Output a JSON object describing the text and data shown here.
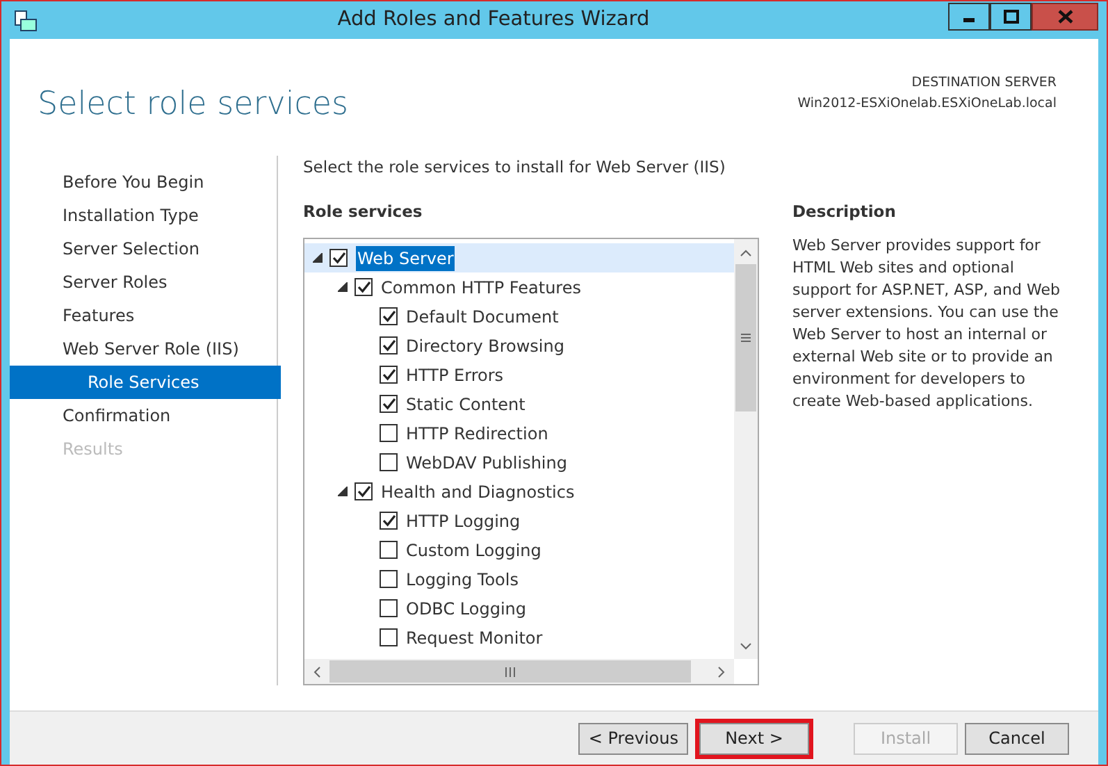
{
  "window": {
    "title": "Add Roles and Features Wizard"
  },
  "header": {
    "title": "Select role services",
    "destination_label": "DESTINATION SERVER",
    "destination_server": "Win2012-ESXiOnelab.ESXiOneLab.local"
  },
  "steps": [
    {
      "label": "Before You Begin",
      "selected": false,
      "disabled": false
    },
    {
      "label": "Installation Type",
      "selected": false,
      "disabled": false
    },
    {
      "label": "Server Selection",
      "selected": false,
      "disabled": false
    },
    {
      "label": "Server Roles",
      "selected": false,
      "disabled": false
    },
    {
      "label": "Features",
      "selected": false,
      "disabled": false
    },
    {
      "label": "Web Server Role (IIS)",
      "selected": false,
      "disabled": false
    },
    {
      "label": "Role Services",
      "selected": true,
      "disabled": false,
      "sub": true
    },
    {
      "label": "Confirmation",
      "selected": false,
      "disabled": false
    },
    {
      "label": "Results",
      "selected": false,
      "disabled": true
    }
  ],
  "instruction": "Select the role services to install for Web Server (IIS)",
  "role_services": {
    "heading": "Role services",
    "tree": [
      {
        "label": "Web Server",
        "checked": true,
        "selected": true,
        "expanded": true,
        "children": [
          {
            "label": "Common HTTP Features",
            "checked": true,
            "selected": false,
            "expanded": true,
            "children": [
              {
                "label": "Default Document",
                "checked": true,
                "selected": false
              },
              {
                "label": "Directory Browsing",
                "checked": true,
                "selected": false
              },
              {
                "label": "HTTP Errors",
                "checked": true,
                "selected": false
              },
              {
                "label": "Static Content",
                "checked": true,
                "selected": false
              },
              {
                "label": "HTTP Redirection",
                "checked": false,
                "selected": false
              },
              {
                "label": "WebDAV Publishing",
                "checked": false,
                "selected": false
              }
            ]
          },
          {
            "label": "Health and Diagnostics",
            "checked": true,
            "selected": false,
            "expanded": true,
            "children": [
              {
                "label": "HTTP Logging",
                "checked": true,
                "selected": false
              },
              {
                "label": "Custom Logging",
                "checked": false,
                "selected": false
              },
              {
                "label": "Logging Tools",
                "checked": false,
                "selected": false
              },
              {
                "label": "ODBC Logging",
                "checked": false,
                "selected": false
              },
              {
                "label": "Request Monitor",
                "checked": false,
                "selected": false
              }
            ]
          }
        ]
      }
    ]
  },
  "description": {
    "heading": "Description",
    "text": "Web Server provides support for HTML Web sites and optional support for ASP.NET, ASP, and Web server extensions. You can use the Web Server to host an internal or external Web site or to provide an environment for developers to create Web-based applications."
  },
  "buttons": [
    {
      "label": "< Previous",
      "disabled": false,
      "highlighted": false
    },
    {
      "label": "Next >",
      "disabled": false,
      "highlighted": true
    },
    {
      "label": "Install",
      "disabled": true,
      "highlighted": false
    },
    {
      "label": "Cancel",
      "disabled": false,
      "highlighted": false
    }
  ]
}
